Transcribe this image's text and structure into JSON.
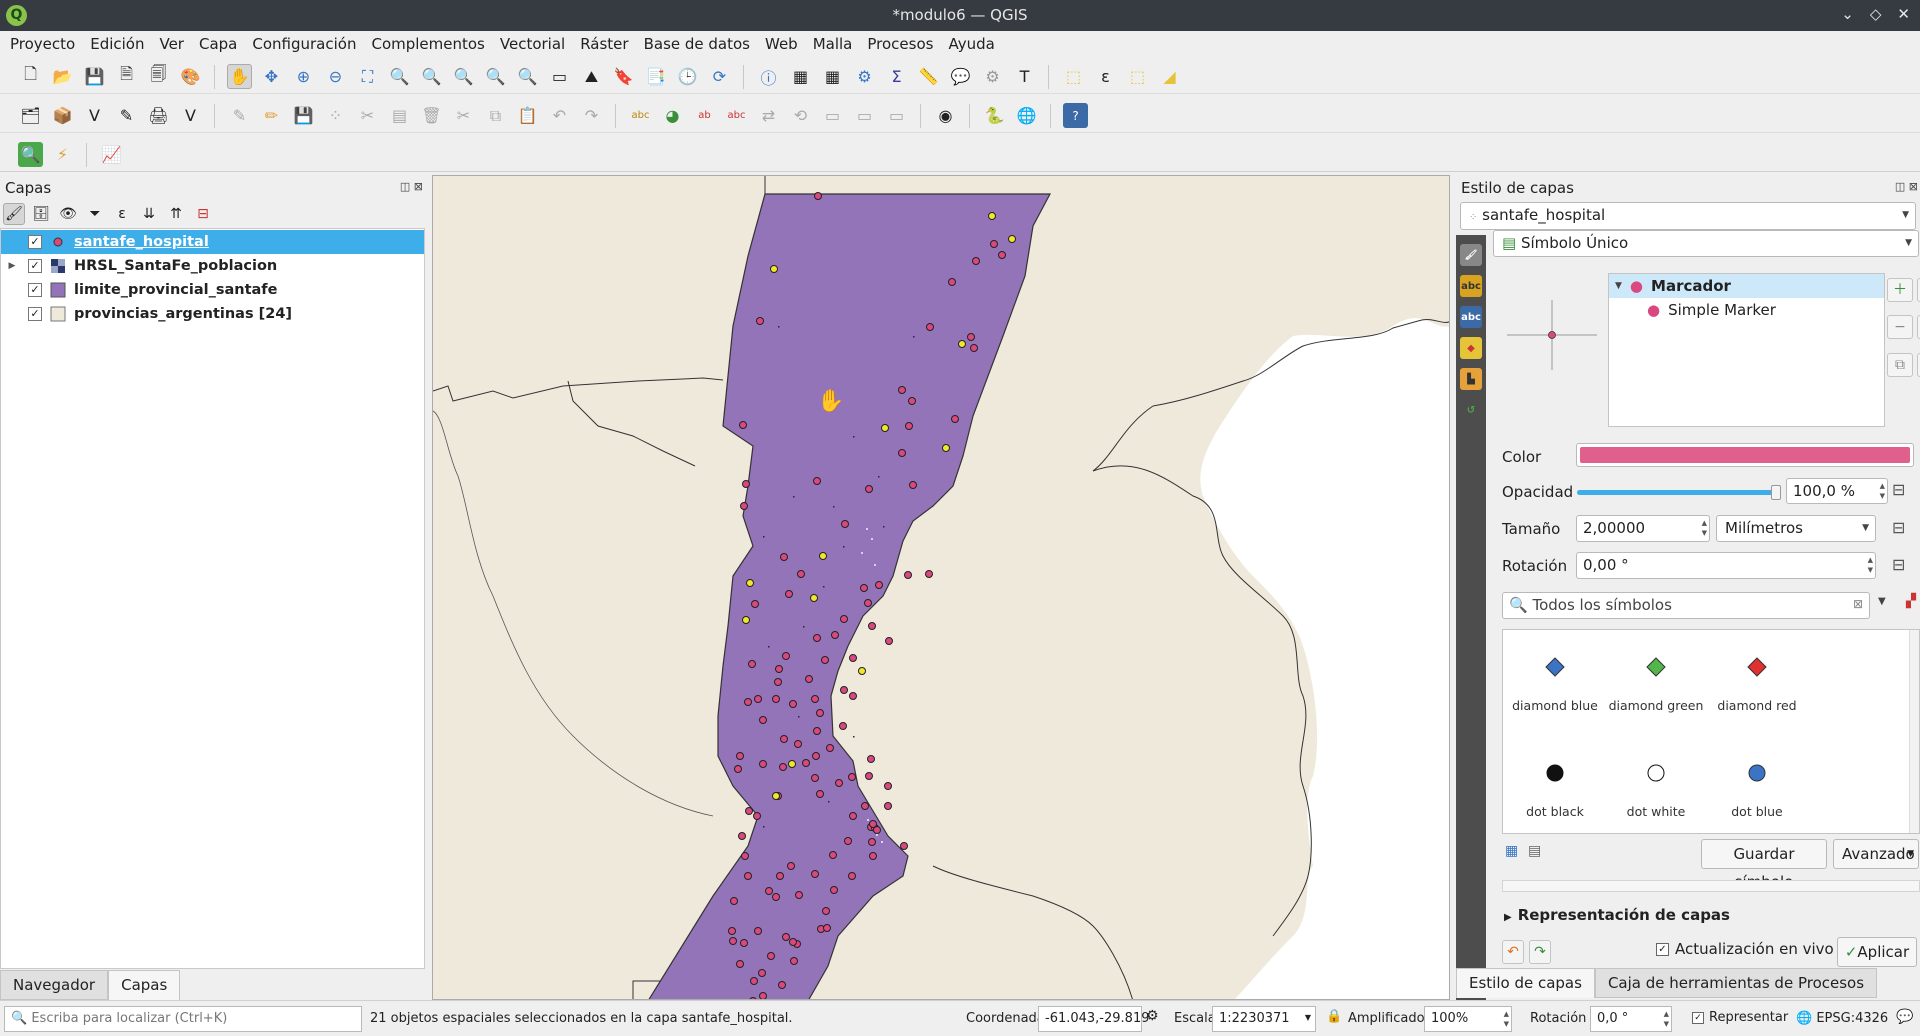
{
  "window": {
    "title": "*modulo6 — QGIS",
    "controls": [
      "⌄",
      "◇",
      "✕"
    ]
  },
  "menu": [
    "Proyecto",
    "Edición",
    "Ver",
    "Capa",
    "Configuración",
    "Complementos",
    "Vectorial",
    "Ráster",
    "Base de datos",
    "Web",
    "Malla",
    "Procesos",
    "Ayuda"
  ],
  "layers_panel": {
    "title": "Capas",
    "layers": [
      {
        "name": "santafe_hospital",
        "checked": true,
        "selected": true,
        "symbol": "point-icon",
        "color": "#d9497f"
      },
      {
        "name": "HRSL_SantaFe_poblacion",
        "checked": true,
        "selected": false,
        "symbol": "raster-icon",
        "color": "#2a3a6b"
      },
      {
        "name": "limite_provincial_santafe",
        "checked": true,
        "selected": false,
        "symbol": "polygon-icon",
        "color": "#9474b8"
      },
      {
        "name": "provincias_argentinas [24]",
        "checked": true,
        "selected": false,
        "symbol": "polygon-icon",
        "color": "#efe9dc"
      }
    ],
    "tabs": [
      "Navegador",
      "Capas"
    ]
  },
  "style_panel": {
    "title": "Estilo de capas",
    "layer": "santafe_hospital",
    "renderer": "Símbolo Único",
    "tree": {
      "root": "Marcador",
      "child": "Simple Marker"
    },
    "color": "#e05f8d",
    "opacity_label": "Opacidad",
    "opacity_value": "100,0 %",
    "opacity_fraction": 1.0,
    "color_label": "Color",
    "size_label": "Tamaño",
    "size_value": "2,00000",
    "unit": "Milímetros",
    "rotation_label": "Rotación",
    "rotation_value": "0,00 °",
    "search_placeholder": "Todos los símbolos",
    "symbols": [
      {
        "name": "diamond blue",
        "color": "#3b74c4",
        "shape": "diamond"
      },
      {
        "name": "diamond green",
        "color": "#53b64a",
        "shape": "diamond"
      },
      {
        "name": "diamond red",
        "color": "#e0302f",
        "shape": "diamond"
      },
      {
        "name": "dot black",
        "color": "#111111",
        "shape": "dot"
      },
      {
        "name": "dot white",
        "color": "#ffffff",
        "shape": "dot"
      },
      {
        "name": "dot blue",
        "color": "#3b74c4",
        "shape": "dot"
      }
    ],
    "save_symbol": "Guardar símbolo",
    "advanced": "Avanzado",
    "layer_rendering": "Representación de capas",
    "live_update": "Actualización en vivo",
    "apply": "Aplicar",
    "tabs": [
      "Estilo de capas",
      "Caja de herramientas de Procesos"
    ]
  },
  "statusbar": {
    "locate_placeholder": "Escriba para localizar (Ctrl+K)",
    "message": "21 objetos espaciales seleccionados en la capa santafe_hospital.",
    "coord_label": "Coordenada",
    "coord_value": "-61.043,-29.819",
    "scale_label": "Escala",
    "scale_value": "1:2230371",
    "magnifier_label": "Amplificador",
    "magnifier_value": "100%",
    "rotation_label": "Rotación",
    "rotation_value": "0,0 °",
    "render_label": "Representar",
    "crs": "EPSG:4326"
  }
}
